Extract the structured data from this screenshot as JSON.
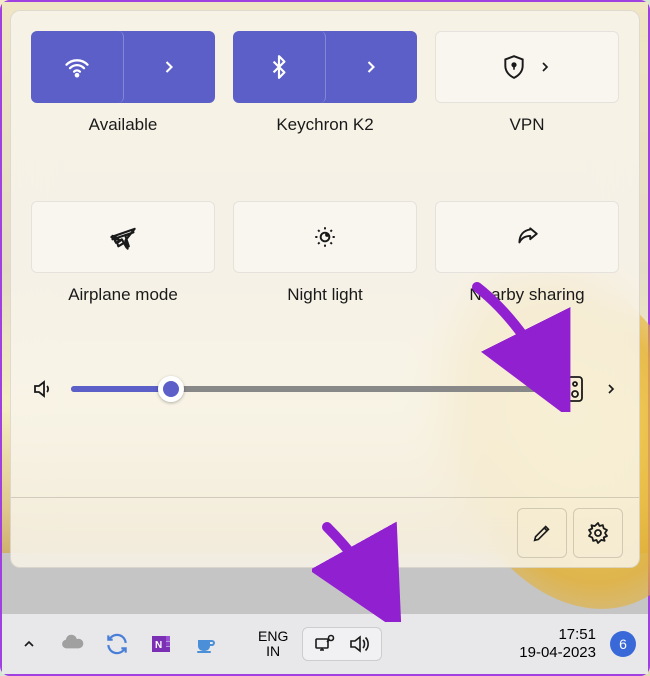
{
  "quick": {
    "tiles": [
      {
        "label": "Available",
        "active": true,
        "split": true,
        "icon": "wifi-icon"
      },
      {
        "label": "Keychron K2",
        "active": true,
        "split": true,
        "icon": "bluetooth-icon"
      },
      {
        "label": "VPN",
        "active": false,
        "split": false,
        "icon": "shield-lock-icon"
      },
      {
        "label": "Airplane mode",
        "active": false,
        "split": false,
        "icon": "airplane-icon"
      },
      {
        "label": "Night light",
        "active": false,
        "split": false,
        "icon": "brightness-icon"
      },
      {
        "label": "Nearby sharing",
        "active": false,
        "split": false,
        "icon": "share-icon"
      }
    ],
    "volume": {
      "percent": 21
    },
    "edit_label": "Edit",
    "settings_label": "Settings"
  },
  "taskbar": {
    "lang_top": "ENG",
    "lang_bottom": "IN",
    "time": "17:51",
    "date": "19-04-2023",
    "notif_count": "6"
  }
}
